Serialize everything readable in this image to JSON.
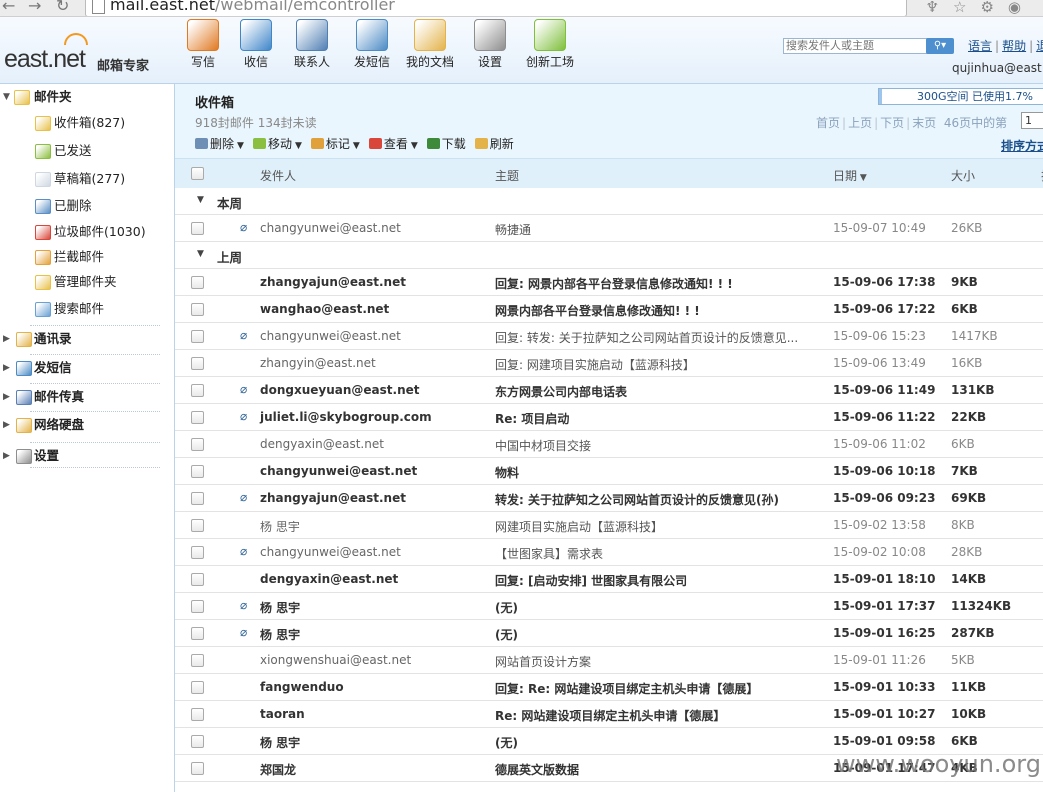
{
  "browser": {
    "url_host": "mail.east.net",
    "url_path": "/webmail/emcontroller"
  },
  "logo": {
    "brand": "east.net",
    "sub": "邮箱专家"
  },
  "toolbar": [
    {
      "label": "写信",
      "icon": "pencil-icon",
      "color": "#e07a22"
    },
    {
      "label": "收信",
      "icon": "inbox-icon",
      "color": "#3f86c9"
    },
    {
      "label": "联系人",
      "icon": "contacts-icon",
      "color": "#4f7fb3"
    },
    {
      "label": "发短信",
      "icon": "sms-icon",
      "color": "#4c8bc4"
    },
    {
      "label": "我的文档",
      "icon": "folder-icon",
      "color": "#e3b34a"
    },
    {
      "label": "设置",
      "icon": "gear-icon",
      "color": "#8e8e8e"
    },
    {
      "label": "创新工场",
      "icon": "flask-icon",
      "color": "#7fbf3a"
    }
  ],
  "search": {
    "placeholder": "搜索发件人或主题"
  },
  "top_links": {
    "lang": "语言",
    "help": "帮助",
    "exit": "退"
  },
  "user": "qujinhua@east",
  "sidebar": {
    "mail_folder": "邮件夹",
    "items": [
      {
        "label": "收件箱(827)",
        "icon": "inbox-icon",
        "color": "#e8c14a"
      },
      {
        "label": "已发送",
        "icon": "sent-icon",
        "color": "#8bbf3f"
      },
      {
        "label": "草稿箱(277)",
        "icon": "draft-icon",
        "color": "#cfd8e2"
      },
      {
        "label": "已删除",
        "icon": "trash-icon",
        "color": "#5a8ec5"
      },
      {
        "label": "垃圾邮件(1030)",
        "icon": "spam-icon",
        "color": "#d9473b"
      },
      {
        "label": "拦截邮件",
        "icon": "block-icon",
        "color": "#e4a23b"
      },
      {
        "label": "管理邮件夹",
        "icon": "manage-folder-icon",
        "color": "#e8c14a"
      },
      {
        "label": "搜索邮件",
        "icon": "search-icon",
        "color": "#6aa1d4"
      }
    ],
    "sections": [
      {
        "label": "通讯录",
        "icon": "address-book-icon",
        "color": "#e3b34a"
      },
      {
        "label": "发短信",
        "icon": "sms-icon",
        "color": "#4c8bc4"
      },
      {
        "label": "邮件传真",
        "icon": "fax-icon",
        "color": "#5a7fb5"
      },
      {
        "label": "网络硬盘",
        "icon": "disk-icon",
        "color": "#e3b34a"
      },
      {
        "label": "设置",
        "icon": "gear-icon",
        "color": "#8e8e8e"
      }
    ]
  },
  "folder": {
    "title": "收件箱",
    "counts": "918封邮件 134封未读",
    "quota_text": "300G空间 已使用1.7%",
    "quota_fraction": 0.017,
    "pager": {
      "first": "首页",
      "prev": "上页",
      "next": "下页",
      "last": "末页",
      "total": "46页中的第",
      "page": "1"
    },
    "sort": "排序方式"
  },
  "actions": [
    {
      "label": "删除",
      "icon": "delete-icon",
      "color": "#6e8fb5",
      "dropdown": true
    },
    {
      "label": "移动",
      "icon": "move-icon",
      "color": "#8bbf3f",
      "dropdown": true
    },
    {
      "label": "标记",
      "icon": "flag-icon",
      "color": "#e0a13a",
      "dropdown": true
    },
    {
      "label": "查看",
      "icon": "view-icon",
      "color": "#d9473b",
      "dropdown": true
    },
    {
      "label": "下载",
      "icon": "download-icon",
      "color": "#3c8a3a",
      "dropdown": false
    },
    {
      "label": "刷新",
      "icon": "refresh-icon",
      "color": "#e3b34a",
      "dropdown": false
    }
  ],
  "columns": {
    "sender": "发件人",
    "subject": "主题",
    "date": "日期",
    "size": "大小",
    "extra": "插"
  },
  "groups": [
    {
      "label": "本周",
      "rows": [
        {
          "sender": "changyunwei@east.net",
          "subject": "畅捷通",
          "date": "15-09-07 10:49",
          "size": "26KB",
          "attach": true,
          "unread": false
        }
      ]
    },
    {
      "label": "上周",
      "rows": [
        {
          "sender": "zhangyajun@east.net",
          "subject": "回复: 网景内部各平台登录信息修改通知! ! !",
          "date": "15-09-06 17:38",
          "size": "9KB",
          "attach": false,
          "unread": true
        },
        {
          "sender": "wanghao@east.net",
          "subject": "网景内部各平台登录信息修改通知! ! !",
          "date": "15-09-06 17:22",
          "size": "6KB",
          "attach": false,
          "unread": true
        },
        {
          "sender": "changyunwei@east.net",
          "subject": "回复: 转发: 关于拉萨知之公司网站首页设计的反馈意见...",
          "date": "15-09-06 15:23",
          "size": "1417KB",
          "attach": true,
          "unread": false
        },
        {
          "sender": "zhangyin@east.net",
          "subject": "回复: 网建项目实施启动【蓝源科技】",
          "date": "15-09-06 13:49",
          "size": "16KB",
          "attach": false,
          "unread": false
        },
        {
          "sender": "dongxueyuan@east.net",
          "subject": "东方网景公司内部电话表",
          "date": "15-09-06 11:49",
          "size": "131KB",
          "attach": true,
          "unread": true
        },
        {
          "sender": "juliet.li@skybogroup.com",
          "subject": "Re: 项目启动",
          "date": "15-09-06 11:22",
          "size": "22KB",
          "attach": true,
          "unread": true
        },
        {
          "sender": "dengyaxin@east.net",
          "subject": "中国中材项目交接",
          "date": "15-09-06 11:02",
          "size": "6KB",
          "attach": false,
          "unread": false
        },
        {
          "sender": "changyunwei@east.net",
          "subject": "物料",
          "date": "15-09-06 10:18",
          "size": "7KB",
          "attach": false,
          "unread": true
        },
        {
          "sender": "zhangyajun@east.net",
          "subject": "转发: 关于拉萨知之公司网站首页设计的反馈意见(孙)",
          "date": "15-09-06 09:23",
          "size": "69KB",
          "attach": true,
          "unread": true
        },
        {
          "sender": "杨 思宇",
          "subject": "网建项目实施启动【蓝源科技】",
          "date": "15-09-02 13:58",
          "size": "8KB",
          "attach": false,
          "unread": false
        },
        {
          "sender": "changyunwei@east.net",
          "subject": "【世图家具】需求表",
          "date": "15-09-02 10:08",
          "size": "28KB",
          "attach": true,
          "unread": false
        },
        {
          "sender": "dengyaxin@east.net",
          "subject": "回复: [启动安排] 世图家具有限公司",
          "date": "15-09-01 18:10",
          "size": "14KB",
          "attach": false,
          "unread": true
        },
        {
          "sender": "杨 思宇",
          "subject": "(无)",
          "date": "15-09-01 17:37",
          "size": "11324KB",
          "attach": true,
          "unread": true
        },
        {
          "sender": "杨 思宇",
          "subject": "(无)",
          "date": "15-09-01 16:25",
          "size": "287KB",
          "attach": true,
          "unread": true
        },
        {
          "sender": "xiongwenshuai@east.net",
          "subject": "网站首页设计方案",
          "date": "15-09-01 11:26",
          "size": "5KB",
          "attach": false,
          "unread": false
        },
        {
          "sender": "fangwenduo",
          "subject": "回复: Re: 网站建设项目绑定主机头申请【德展】",
          "date": "15-09-01 10:33",
          "size": "11KB",
          "attach": false,
          "unread": true
        },
        {
          "sender": "taoran",
          "subject": "Re: 网站建设项目绑定主机头申请【德展】",
          "date": "15-09-01 10:27",
          "size": "10KB",
          "attach": false,
          "unread": true
        },
        {
          "sender": "杨 思宇",
          "subject": "(无)",
          "date": "15-09-01 09:58",
          "size": "6KB",
          "attach": false,
          "unread": true
        },
        {
          "sender": "郑国龙",
          "subject": "德展英文版数据",
          "date": "15-09-01 17:47",
          "size": "4KB",
          "attach": false,
          "unread": true
        }
      ]
    }
  ],
  "watermark": "www.wooyun.org"
}
